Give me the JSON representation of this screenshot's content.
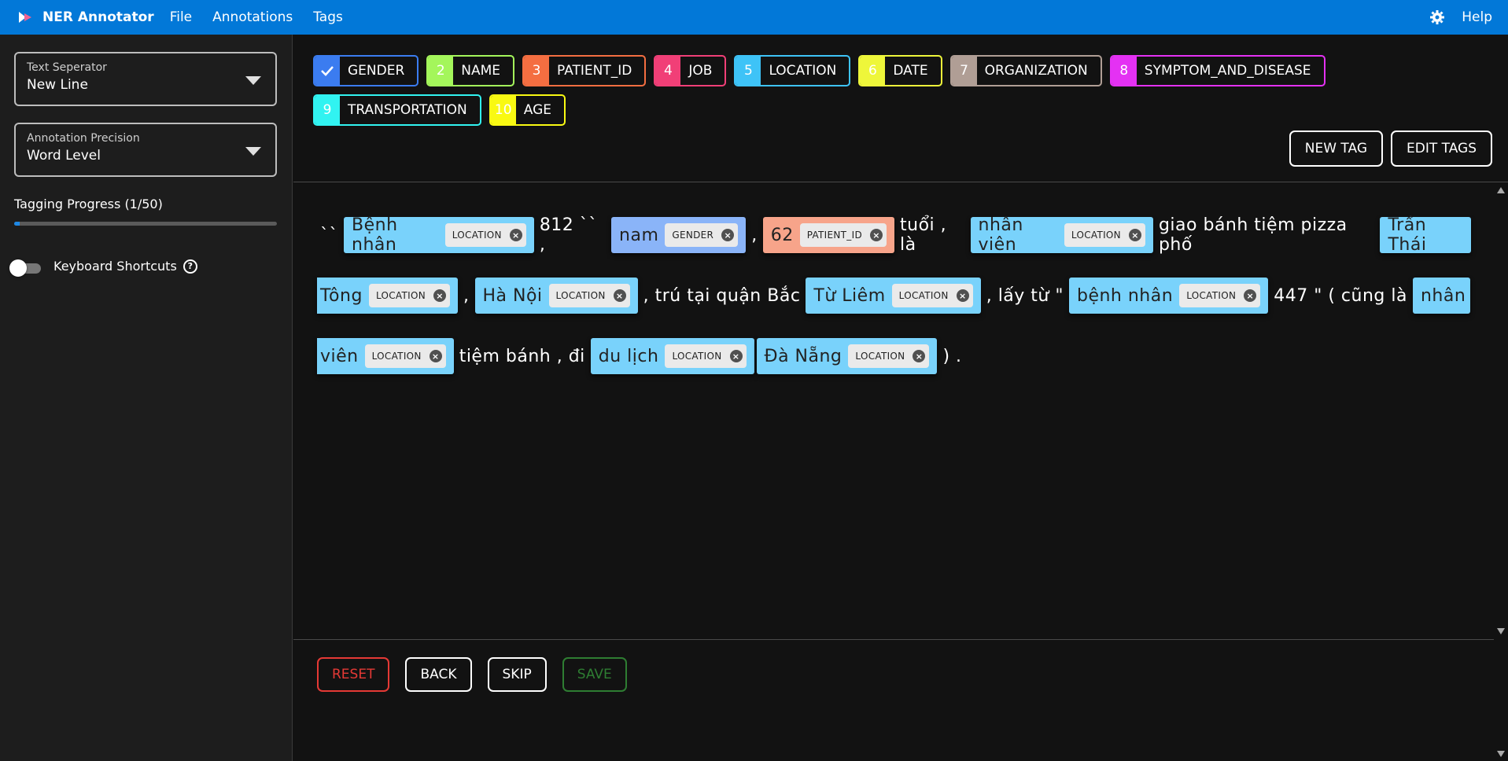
{
  "appbar": {
    "title": "NER Annotator",
    "menu": [
      "File",
      "Annotations",
      "Tags"
    ],
    "help": "Help"
  },
  "sidebar": {
    "separator": {
      "label": "Text Seperator",
      "value": "New Line"
    },
    "precision": {
      "label": "Annotation Precision",
      "value": "Word Level"
    },
    "progress": {
      "label": "Tagging Progress (1/50)",
      "fraction": 0.02
    },
    "shortcuts": {
      "label": "Keyboard Shortcuts",
      "enabled": false
    }
  },
  "tags": [
    {
      "num": "",
      "name": "GENDER",
      "color": "#3b7cf0",
      "checked": true
    },
    {
      "num": "2",
      "name": "NAME",
      "color": "#a4f65b"
    },
    {
      "num": "3",
      "name": "PATIENT_ID",
      "color": "#f46e41"
    },
    {
      "num": "4",
      "name": "JOB",
      "color": "#f13f77"
    },
    {
      "num": "5",
      "name": "LOCATION",
      "color": "#3ec3f7"
    },
    {
      "num": "6",
      "name": "DATE",
      "color": "#eef63a"
    },
    {
      "num": "7",
      "name": "ORGANIZATION",
      "color": "#b09e95"
    },
    {
      "num": "8",
      "name": "SYMPTOM_AND_DISEASE",
      "color": "#e431f3"
    },
    {
      "num": "9",
      "name": "TRANSPORTATION",
      "color": "#31f3f1"
    },
    {
      "num": "10",
      "name": "AGE",
      "color": "#f9f912"
    }
  ],
  "tag_actions": {
    "new": "NEW TAG",
    "edit": "EDIT TAGS"
  },
  "text": {
    "line1": {
      "w1": "``",
      "e1": {
        "text": "Bệnh nhân",
        "tag": "LOCATION"
      },
      "w2": "812 `` ,",
      "e2": {
        "text": "nam",
        "tag": "GENDER"
      },
      "w3": ",",
      "e3": {
        "text": "62",
        "tag": "PATIENT_ID"
      },
      "w4": "tuổi , là",
      "e4": {
        "text": "nhân viên",
        "tag": "LOCATION"
      },
      "w5": "giao bánh tiệm pizza phố",
      "e5": {
        "text": "Trần Thái"
      }
    },
    "line2": {
      "e1": {
        "text": "Tông",
        "tag": "LOCATION"
      },
      "w1": ",",
      "e2": {
        "text": "Hà Nội",
        "tag": "LOCATION"
      },
      "w2": ", trú tại quận Bắc",
      "e3": {
        "text": "Từ Liêm",
        "tag": "LOCATION"
      },
      "w3": ", lấy từ \"",
      "e4": {
        "text": "bệnh nhân",
        "tag": "LOCATION"
      },
      "w4": "447 \" ( cũng là",
      "e5": {
        "text": "nhân"
      }
    },
    "line3": {
      "e1": {
        "text": "viên",
        "tag": "LOCATION"
      },
      "w1": "tiệm bánh , đi",
      "e2": {
        "text": "du lịch",
        "tag": "LOCATION"
      },
      "e3": {
        "text": "Đà Nẵng",
        "tag": "LOCATION"
      },
      "w2": ") ."
    },
    "remove_glyph": "×"
  },
  "actions": {
    "reset": "RESET",
    "back": "BACK",
    "skip": "SKIP",
    "save": "SAVE"
  }
}
